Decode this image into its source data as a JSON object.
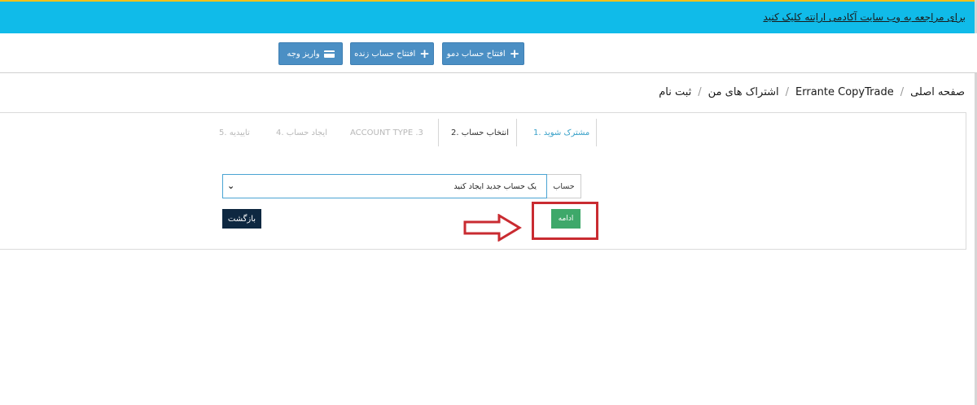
{
  "topbar": {
    "link_text": "برای مراجعه به وب سایت آکادمی اراِنته کلیک کنید"
  },
  "toolbar": {
    "demo_label": "افتتاح حساب دمو",
    "live_label": "افتتاح حساب زنده",
    "deposit_label": "واریز وجه"
  },
  "breadcrumb": {
    "items": [
      "صفحه اصلی",
      "Errante CopyTrade",
      "اشتراک های من",
      "ثبت نام"
    ]
  },
  "steps": [
    {
      "label": "مشترک شوید .1",
      "state": "active"
    },
    {
      "label": "انتخاب حساب .2",
      "state": "done"
    },
    {
      "label": "ACCOUNT TYPE .3",
      "state": "disabled"
    },
    {
      "label": "ایجاد حساب .4",
      "state": "disabled"
    },
    {
      "label": "تاییدیه .5",
      "state": "disabled"
    }
  ],
  "form": {
    "account_addon": "حساب",
    "account_select_value": "یک حساب جدید ایجاد کنید",
    "back_label": "بازگشت",
    "continue_label": "ادامه"
  },
  "colors": {
    "topbar": "#10bbe9",
    "toolbar_button": "#4b8fc4",
    "continue": "#3ea86a",
    "back": "#0e2841",
    "annotation": "#c92b31"
  }
}
